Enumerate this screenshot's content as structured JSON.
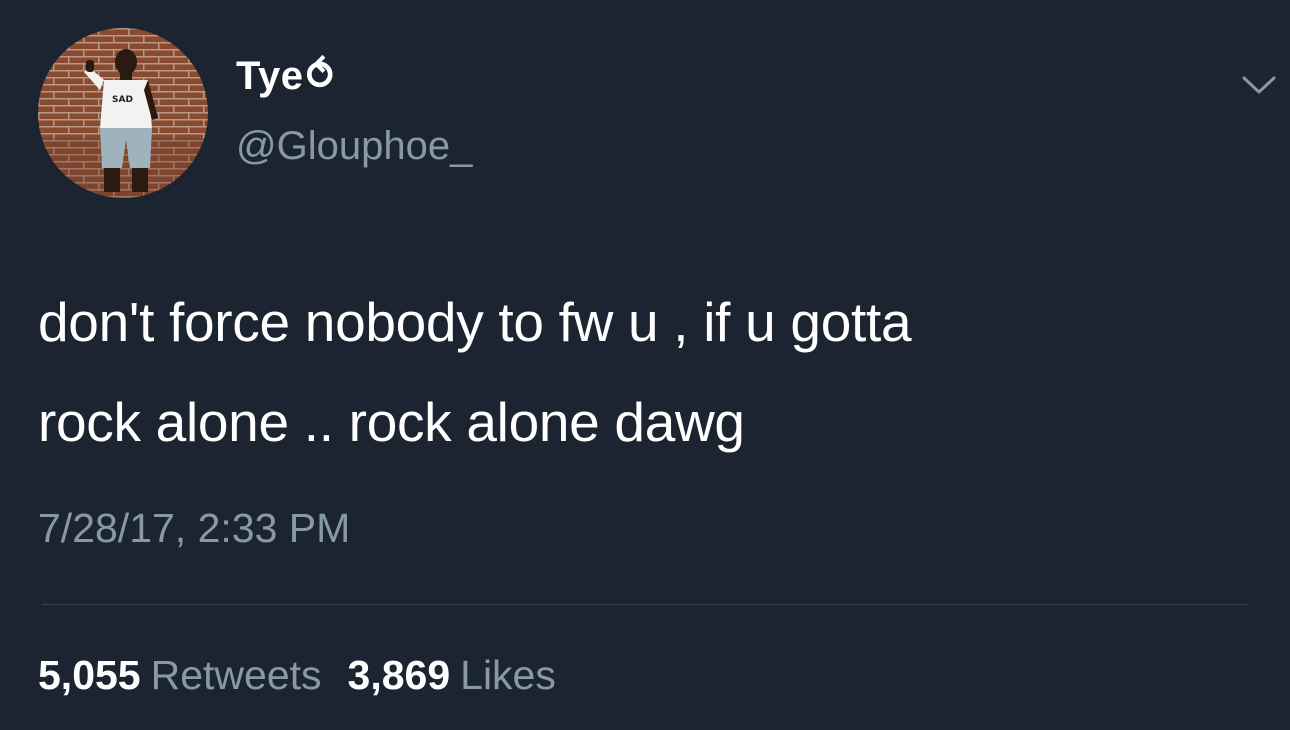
{
  "user": {
    "display_name": "Tye⥀",
    "handle": "@Glouphoe_"
  },
  "tweet": {
    "text": "don't force nobody to fw u , if u gotta\nrock alone .. rock alone dawg",
    "timestamp": "7/28/17, 2:33 PM"
  },
  "stats": {
    "retweets_count": "5,055",
    "retweets_label": "Retweets",
    "likes_count": "3,869",
    "likes_label": "Likes"
  },
  "icons": {
    "menu": "chevron-down-icon"
  },
  "colors": {
    "background": "#1b2430",
    "primary_text": "#ffffff",
    "secondary_text": "#8899a6",
    "divider": "#38444d"
  }
}
